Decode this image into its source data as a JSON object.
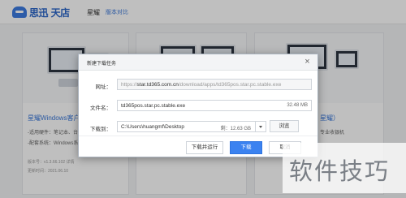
{
  "header": {
    "logo_text": "思迅 天店",
    "title": "星耀",
    "link": "版本对比"
  },
  "cards": [
    {
      "title": "星耀Windows客户端",
      "line1": "-适用硬件：笔记本、台式机",
      "line2": "-配套系统：Windows系统",
      "meta1": "版本号：v1.3.66.102  详情",
      "meta2": "更新时间：2021.06.10"
    },
    {
      "title": "",
      "line1": "",
      "line2": "",
      "meta1": "",
      "meta2": ""
    },
    {
      "title": "星耀）",
      "line1": "专业收银机",
      "line2": "",
      "meta1": "",
      "meta2": ""
    }
  ],
  "dialog": {
    "title": "新建下载任务",
    "close": "×",
    "url_label": "网址：",
    "url_prefix": "https://",
    "url_host": "star.td365.com.cn",
    "url_path": "/download/apps/td365pos.star.pc.stable.exe",
    "filename_label": "文件名：",
    "filename": "td365pos.star.pc.stable.exe",
    "filesize": "32.48 MB",
    "saveto_label": "下载到：",
    "path": "C:\\Users\\huangmf\\Desktop",
    "free_space": "剩：12.63 GB",
    "browse": "浏览",
    "download_open": "下载并运行",
    "download": "下载",
    "cancel": "取消"
  },
  "watermark": "软件技巧"
}
